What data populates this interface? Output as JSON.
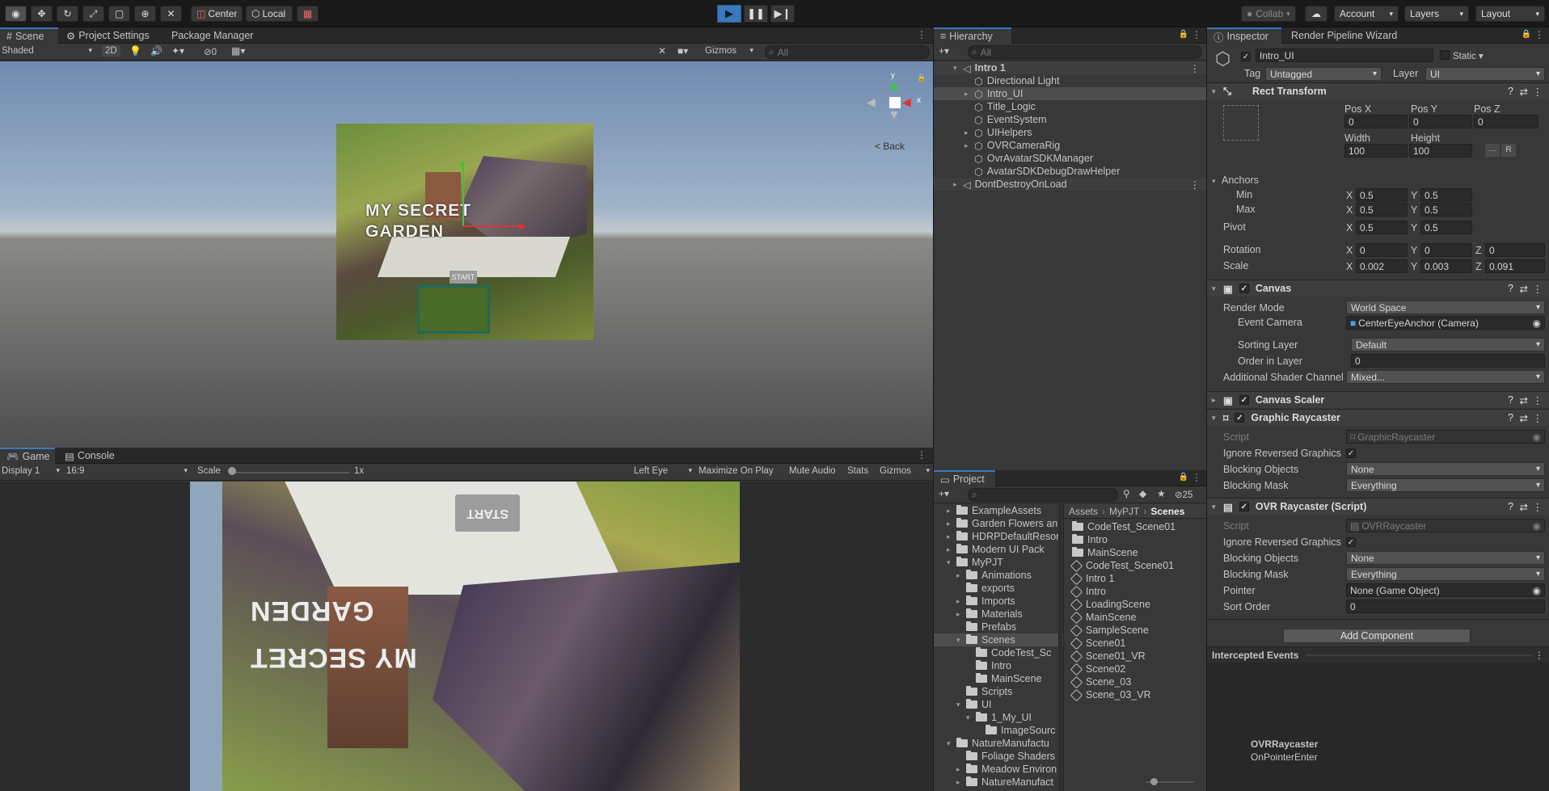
{
  "toolbar": {
    "pivot_label": "Center",
    "space_label": "Local",
    "collab_label": "Collab",
    "account_label": "Account",
    "layers_label": "Layers",
    "layout_label": "Layout"
  },
  "scene": {
    "tabs": [
      "Scene",
      "Project Settings",
      "Package Manager"
    ],
    "shading": "Shaded",
    "mode_2d": "2D",
    "hidden_count": "0",
    "gizmos": "Gizmos",
    "search_placeholder": "All",
    "back_label": "< Back",
    "axis_y": "y",
    "axis_x": "x",
    "ui_title_line1": "MY SECRET",
    "ui_title_line2": "GARDEN",
    "ui_start": "START"
  },
  "game": {
    "tabs": [
      "Game",
      "Console"
    ],
    "display": "Display 1",
    "aspect": "16:9",
    "scale_label": "Scale",
    "scale_value": "1x",
    "eye": "Left Eye",
    "maximize": "Maximize On Play",
    "mute": "Mute Audio",
    "stats": "Stats",
    "gizmos": "Gizmos",
    "ui_title_line1": "MY SECRET",
    "ui_title_line2": "GARDEN",
    "ui_start": "START"
  },
  "hierarchy": {
    "tab": "Hierarchy",
    "search_placeholder": "All",
    "items": [
      {
        "label": "Intro 1",
        "indent": 0,
        "scene": true
      },
      {
        "label": "Directional Light",
        "indent": 1
      },
      {
        "label": "Intro_UI",
        "indent": 1,
        "selected": true
      },
      {
        "label": "Title_Logic",
        "indent": 1
      },
      {
        "label": "EventSystem",
        "indent": 1
      },
      {
        "label": "UIHelpers",
        "indent": 1
      },
      {
        "label": "OVRCameraRig",
        "indent": 1
      },
      {
        "label": "OvrAvatarSDKManager",
        "indent": 1
      },
      {
        "label": "AvatarSDKDebugDrawHelper",
        "indent": 1
      },
      {
        "label": "DontDestroyOnLoad",
        "indent": 0,
        "scene": true
      }
    ]
  },
  "project": {
    "tab": "Project",
    "count": "25",
    "breadcrumb": [
      "Assets",
      "MyPJT",
      "Scenes"
    ],
    "tree": [
      {
        "label": "ExampleAssets",
        "indent": 1
      },
      {
        "label": "Garden Flowers an",
        "indent": 1
      },
      {
        "label": "HDRPDefaultResor",
        "indent": 1
      },
      {
        "label": "Modern UI Pack",
        "indent": 1
      },
      {
        "label": "MyPJT",
        "indent": 1
      },
      {
        "label": "Animations",
        "indent": 2
      },
      {
        "label": "exports",
        "indent": 2
      },
      {
        "label": "Imports",
        "indent": 2
      },
      {
        "label": "Materials",
        "indent": 2
      },
      {
        "label": "Prefabs",
        "indent": 2
      },
      {
        "label": "Scenes",
        "indent": 2
      },
      {
        "label": "CodeTest_Sc",
        "indent": 3
      },
      {
        "label": "Intro",
        "indent": 3
      },
      {
        "label": "MainScene",
        "indent": 3
      },
      {
        "label": "Scripts",
        "indent": 2
      },
      {
        "label": "UI",
        "indent": 2
      },
      {
        "label": "1_My_UI",
        "indent": 3
      },
      {
        "label": "ImageSourc",
        "indent": 4
      },
      {
        "label": "NatureManufactu",
        "indent": 1
      },
      {
        "label": "Foliage Shaders",
        "indent": 2
      },
      {
        "label": "Meadow Environ",
        "indent": 2
      },
      {
        "label": "NatureManufact",
        "indent": 2
      }
    ],
    "files": [
      {
        "label": "CodeTest_Scene01",
        "folder": true
      },
      {
        "label": "Intro",
        "folder": true
      },
      {
        "label": "MainScene",
        "folder": true
      },
      {
        "label": "CodeTest_Scene01"
      },
      {
        "label": "Intro 1"
      },
      {
        "label": "Intro"
      },
      {
        "label": "LoadingScene"
      },
      {
        "label": "MainScene"
      },
      {
        "label": "SampleScene"
      },
      {
        "label": "Scene01"
      },
      {
        "label": "Scene01_VR"
      },
      {
        "label": "Scene02"
      },
      {
        "label": "Scene_03"
      },
      {
        "label": "Scene_03_VR"
      }
    ]
  },
  "inspector": {
    "tabs": [
      "Inspector",
      "Render Pipeline Wizard"
    ],
    "object_name": "Intro_UI",
    "static_label": "Static",
    "tag_label": "Tag",
    "tag_value": "Untagged",
    "layer_label": "Layer",
    "layer_value": "UI",
    "rect_transform": {
      "title": "Rect Transform",
      "posx_label": "Pos X",
      "posy_label": "Pos Y",
      "posz_label": "Pos Z",
      "posx": "0",
      "posy": "0",
      "posz": "0",
      "width_label": "Width",
      "height_label": "Height",
      "width": "100",
      "height": "100",
      "r_label": "R",
      "anchors_label": "Anchors",
      "min_label": "Min",
      "max_label": "Max",
      "min_x": "0.5",
      "min_y": "0.5",
      "max_x": "0.5",
      "max_y": "0.5",
      "pivot_label": "Pivot",
      "pivot_x": "0.5",
      "pivot_y": "0.5",
      "rotation_label": "Rotation",
      "rot_x": "0",
      "rot_y": "0",
      "rot_z": "0",
      "scale_label": "Scale",
      "scale_x": "0.002",
      "scale_y": "0.003",
      "scale_z": "0.091",
      "x": "X",
      "y": "Y",
      "z": "Z"
    },
    "canvas": {
      "title": "Canvas",
      "render_mode_label": "Render Mode",
      "render_mode": "World Space",
      "event_camera_label": "Event Camera",
      "event_camera": "CenterEyeAnchor (Camera)",
      "sorting_layer_label": "Sorting Layer",
      "sorting_layer": "Default",
      "order_label": "Order in Layer",
      "order": "0",
      "shader_label": "Additional Shader Channel",
      "shader": "Mixed..."
    },
    "canvas_scaler": {
      "title": "Canvas Scaler"
    },
    "graphic_raycaster": {
      "title": "Graphic Raycaster",
      "script_label": "Script",
      "script": "GraphicRaycaster",
      "ignore_label": "Ignore Reversed Graphics",
      "blocking_objects_label": "Blocking Objects",
      "blocking_objects": "None",
      "blocking_mask_label": "Blocking Mask",
      "blocking_mask": "Everything"
    },
    "ovr_raycaster": {
      "title": "OVR Raycaster (Script)",
      "script_label": "Script",
      "script": "OVRRaycaster",
      "ignore_label": "Ignore Reversed Graphics",
      "blocking_objects_label": "Blocking Objects",
      "blocking_objects": "None",
      "blocking_mask_label": "Blocking Mask",
      "blocking_mask": "Everything",
      "pointer_label": "Pointer",
      "pointer": "None (Game Object)",
      "sort_order_label": "Sort Order",
      "sort_order": "0"
    },
    "add_component": "Add Component",
    "intercepted_events": "Intercepted Events",
    "event_class": "OVRRaycaster",
    "event_method": "OnPointerEnter"
  }
}
